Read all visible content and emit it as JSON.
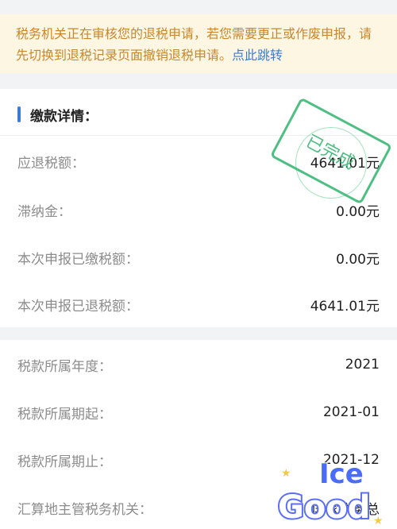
{
  "notice": {
    "text": "税务机关正在审核您的退税申请，若您需要更正或作废申报，请先切换到退税记录页面撤销退税申请。",
    "link": "点此跳转"
  },
  "payment": {
    "title": "缴款详情：",
    "stamp": "已完成",
    "rows": [
      {
        "label": "应退税额：",
        "value": "4641.01元"
      },
      {
        "label": "滞纳金：",
        "value": "0.00元"
      },
      {
        "label": "本次申报已缴税额：",
        "value": "0.00元"
      },
      {
        "label": "本次申报已退税额：",
        "value": "4641.01元"
      }
    ]
  },
  "tax_info": {
    "rows": [
      {
        "label": "税款所属年度：",
        "value": "2021"
      },
      {
        "label": "税款所属期起：",
        "value": "2021-01"
      },
      {
        "label": "税款所属期止：",
        "value": "2021-12"
      },
      {
        "label": "汇算地主管税务机关：",
        "value": "国家税务总"
      }
    ]
  },
  "sticker": {
    "text_top": "Ice",
    "text_main": "Good"
  },
  "colors": {
    "accent": "#3a7bd5",
    "notice_text": "#c8872b",
    "notice_bg": "#fdf6e3",
    "stamp": "#2fb56d"
  }
}
